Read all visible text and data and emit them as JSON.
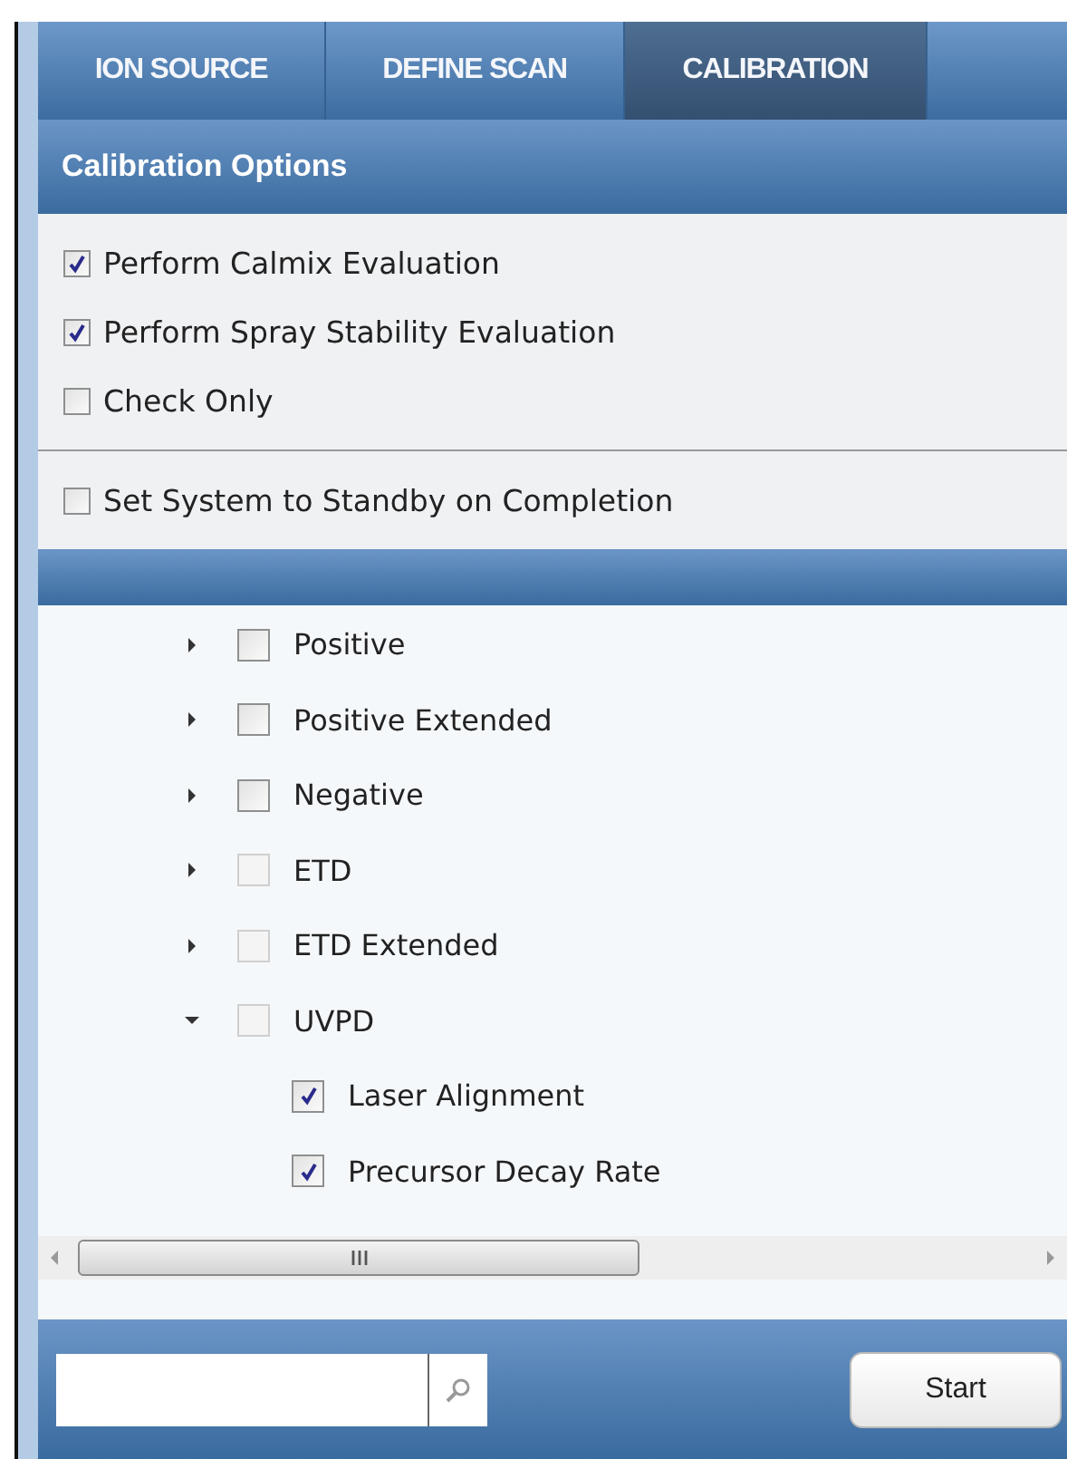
{
  "tabs": [
    {
      "label": "ION SOURCE",
      "selected": false
    },
    {
      "label": "DEFINE SCAN",
      "selected": false
    },
    {
      "label": "CALIBRATION",
      "selected": true
    }
  ],
  "options_header": {
    "title": "Calibration Options"
  },
  "options": [
    {
      "label": "Perform Calmix Evaluation",
      "checked": true
    },
    {
      "label": "Perform Spray Stability Evaluation",
      "checked": true
    },
    {
      "label": "Check Only",
      "checked": false
    }
  ],
  "standby_option": {
    "label": "Set System to Standby on Completion",
    "checked": false
  },
  "tree": [
    {
      "label": "Positive",
      "checked": false,
      "disabled": false,
      "expanded": false
    },
    {
      "label": "Positive Extended",
      "checked": false,
      "disabled": false,
      "expanded": false
    },
    {
      "label": "Negative",
      "checked": false,
      "disabled": false,
      "expanded": false
    },
    {
      "label": "ETD",
      "checked": false,
      "disabled": true,
      "expanded": false
    },
    {
      "label": "ETD Extended",
      "checked": false,
      "disabled": true,
      "expanded": false
    },
    {
      "label": "UVPD",
      "checked": false,
      "disabled": true,
      "expanded": true,
      "children": [
        {
          "label": "Laser Alignment",
          "checked": true,
          "disabled": false
        },
        {
          "label": "Precursor Decay Rate",
          "checked": true,
          "disabled": false
        }
      ]
    }
  ],
  "footer": {
    "start_button": "Start"
  }
}
